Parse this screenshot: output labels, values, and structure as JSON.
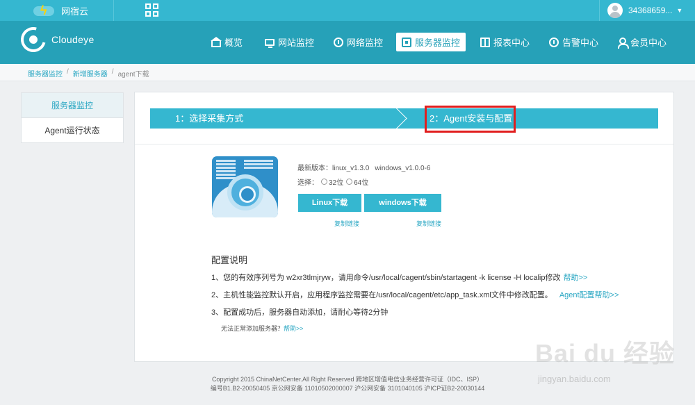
{
  "topbar": {
    "logo_text": "网宿云",
    "username": "34368659..."
  },
  "brand": "Cloudeye",
  "nav": [
    {
      "label": "概览"
    },
    {
      "label": "网站监控"
    },
    {
      "label": "网络监控"
    },
    {
      "label": "服务器监控"
    },
    {
      "label": "报表中心"
    },
    {
      "label": "告警中心"
    },
    {
      "label": "会员中心"
    }
  ],
  "breadcrumb": [
    "服务器监控",
    "新增服务器",
    "agent下载"
  ],
  "leftmenu": [
    {
      "label": "服务器监控",
      "active": true
    },
    {
      "label": "Agent运行状态",
      "active": false
    }
  ],
  "steps": {
    "step1": "1：选择采集方式",
    "step2": "2：Agent安装与配置"
  },
  "version": {
    "label": "最新版本：",
    "linux": "linux_v1.3.0",
    "windows": "windows_v1.0.0-6"
  },
  "arch": {
    "label": "选择：",
    "opt32": "32位",
    "opt64": "64位"
  },
  "buttons": {
    "linux": "Linux下载",
    "windows": "windows下载",
    "copy": "复制链接"
  },
  "config": {
    "title": "配置说明",
    "line1": "1、您的有效序列号为 w2xr3tlmjryw，请用命令/usr/local/cagent/sbin/startagent -k license -H localip修改",
    "line1_help": "帮助>>",
    "line2": "2、主机性能监控默认开启，应用程序监控需要在/usr/local/cagent/etc/app_task.xml文件中修改配置。",
    "line2_help": "Agent配置帮助>>",
    "line3": "3、配置成功后，服务器自动添加，请耐心等待2分钟",
    "note": "无法正常添加服务器？",
    "note_help": "帮助>>"
  },
  "footer": {
    "line1": "Copyright 2015 ChinaNetCenter.All Right Reserved 跨地区增值电信业务经营许可证（IDC、ISP）",
    "line2": "编号B1.B2-20050405 京公网安备 11010502000007 沪公网安备 3101040105 沪ICP证B2-20030144"
  },
  "watermark": {
    "big": "Bai du 经验",
    "small": "jingyan.baidu.com"
  },
  "colors": {
    "topbar": "#35b7d0",
    "navbar": "#26a1b8",
    "accent": "#2aa7c3",
    "highlight": "#e11e1e"
  }
}
